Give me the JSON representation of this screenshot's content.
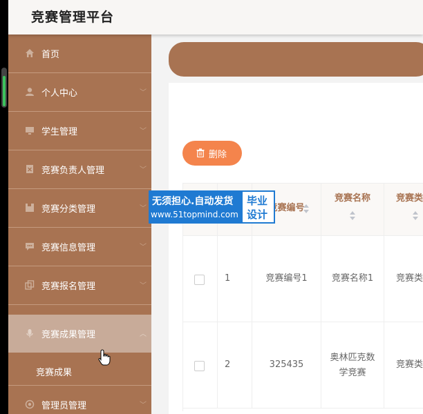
{
  "app": {
    "title": "竞赛管理平台"
  },
  "sidebar": {
    "items": [
      {
        "label": "首页",
        "icon": "home-icon"
      },
      {
        "label": "个人中心",
        "icon": "user-icon"
      },
      {
        "label": "学生管理",
        "icon": "monitor-icon"
      },
      {
        "label": "竞赛负责人管理",
        "icon": "delete-doc-icon"
      },
      {
        "label": "竞赛分类管理",
        "icon": "folder-icon"
      },
      {
        "label": "竞赛信息管理",
        "icon": "chat-icon"
      },
      {
        "label": "竞赛报名管理",
        "icon": "copy-icon"
      },
      {
        "label": "竞赛成果管理",
        "icon": "microphone-icon"
      },
      {
        "label": "管理员管理",
        "icon": "settings-icon"
      }
    ],
    "submenu": [
      {
        "label": "竞赛成果"
      }
    ]
  },
  "toolbar": {
    "delete_label": "删除"
  },
  "table": {
    "columns": [
      "竞赛编号",
      "竞赛名称",
      "竞赛类"
    ],
    "rows": [
      {
        "index": "1",
        "code": "竞赛编号1",
        "name": "竞赛名称1",
        "type": "竞赛类"
      },
      {
        "index": "2",
        "code": "325435",
        "name_line1": "奥林匹克数",
        "name_line2": "学竞赛",
        "type": "竞赛类"
      }
    ]
  },
  "watermark": {
    "line1": "无须担心.自动发货",
    "line2": "www.51topmind.com",
    "tag1": "毕业",
    "tag2": "设计"
  },
  "colors": {
    "primary": "#a87352",
    "accent": "#f4844c",
    "active": "#c8ab99"
  }
}
